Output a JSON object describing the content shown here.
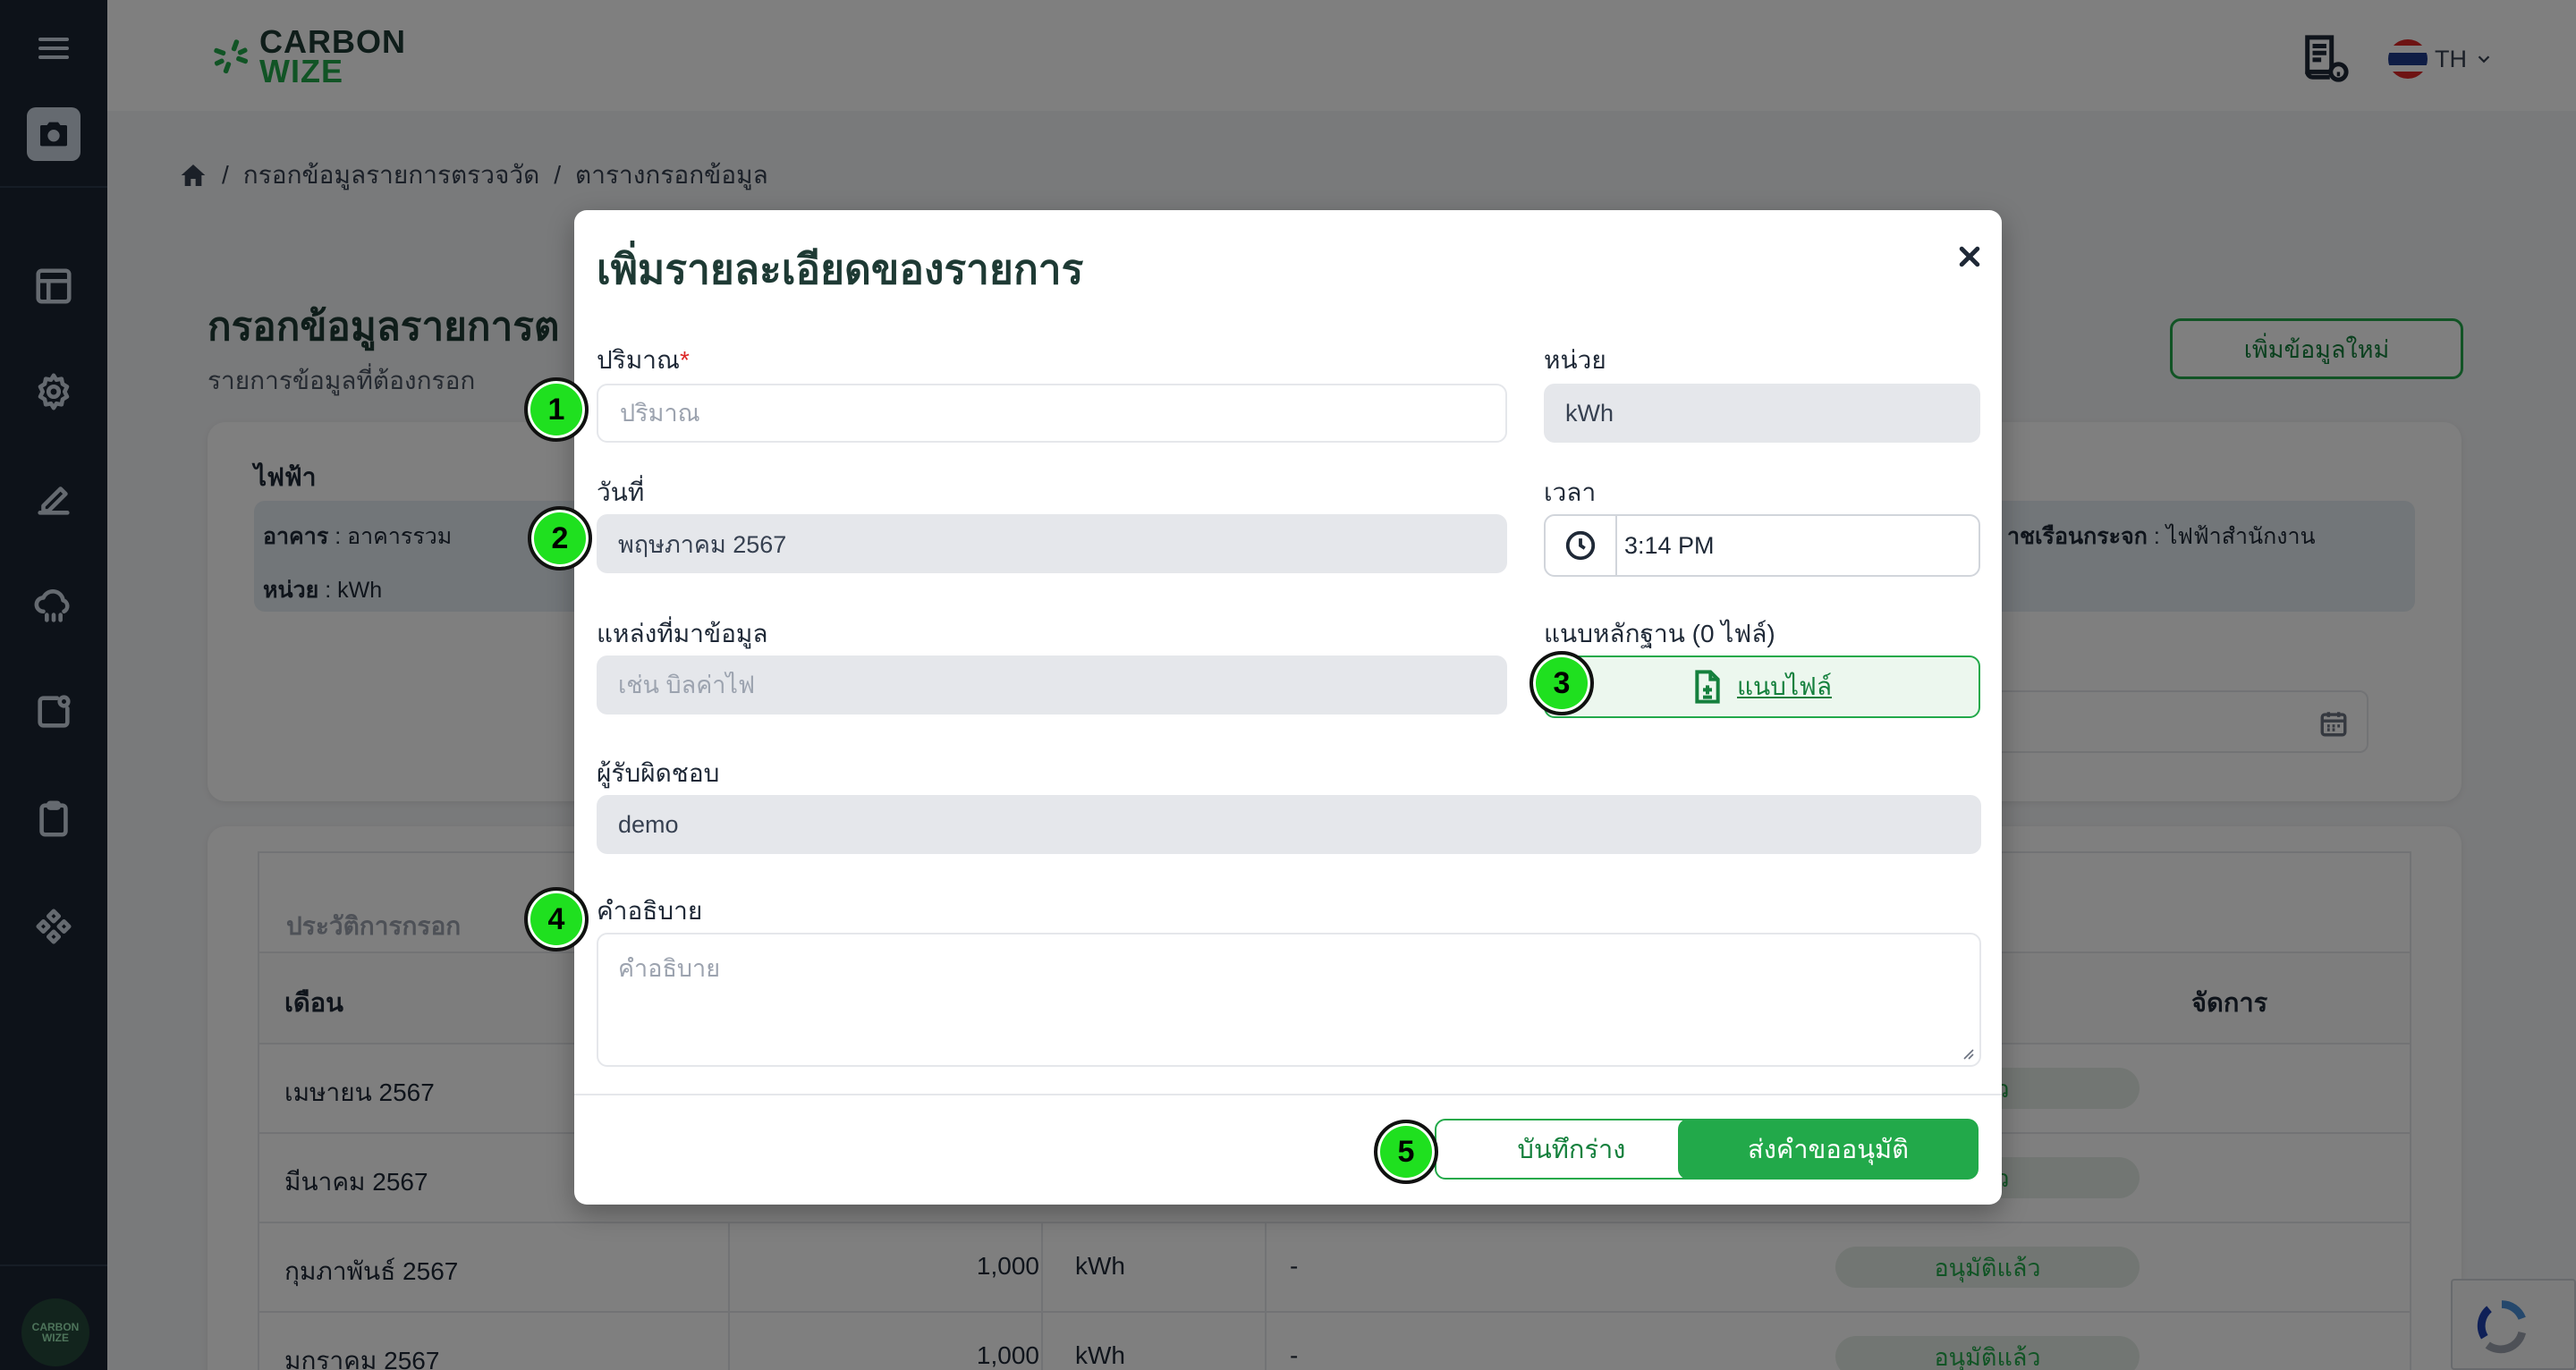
{
  "header": {
    "logo_line1": "CARBON",
    "logo_line2": "WIZE",
    "lang": "TH"
  },
  "sidebar": {
    "logo_line1": "CARBON",
    "logo_line2": "WIZE"
  },
  "breadcrumb": {
    "sep": "/",
    "item1": "กรอกข้อมูลรายการตรวจวัด",
    "item2": "ตารางกรอกข้อมูล"
  },
  "page": {
    "title": "กรอกข้อมูลรายการต",
    "subtitle": "รายการข้อมูลที่ต้องกรอก",
    "add_new": "เพิ่มข้อมูลใหม่"
  },
  "info": {
    "heading": "ไฟฟ้า",
    "building_label": "อาคาร",
    "building_value": " : อาคารรวม",
    "unit_label": "หน่วย",
    "unit_value": " : kWh",
    "right_label": "าชเรือนกระจก",
    "right_value": " : ไฟฟ้าสำนักงาน"
  },
  "history": {
    "title": "ประวัติการกรอก",
    "col_month": "เดือน",
    "col_manage": "จัดการ",
    "rows": [
      {
        "month": "เมษายน 2567",
        "amount": "",
        "unit": "",
        "note": "",
        "status": "แล้ว"
      },
      {
        "month": "มีนาคม 2567",
        "amount": "",
        "unit": "",
        "note": "",
        "status": "แล้ว"
      },
      {
        "month": "กุมภาพันธ์ 2567",
        "amount": "1,000",
        "unit": "kWh",
        "note": "-",
        "status": "อนุมัติแล้ว"
      },
      {
        "month": "มกราคม 2567",
        "amount": "1,000",
        "unit": "kWh",
        "note": "-",
        "status": "อนุมัติแล้ว"
      }
    ]
  },
  "modal": {
    "title": "เพิ่มรายละเอียดของรายการ",
    "quantity_label": "ปริมาณ",
    "required_mark": "*",
    "quantity_placeholder": "ปริมาณ",
    "unit_label": "หน่วย",
    "unit_value": "kWh",
    "date_label": "วันที่",
    "date_value": "พฤษภาคม 2567",
    "time_label": "เวลา",
    "time_value": "3:14 PM",
    "source_label": "แหล่งที่มาข้อมูล",
    "source_placeholder": "เช่น บิลค่าไฟ",
    "evidence_label": "แนบหลักฐาน (0 ไฟล์)",
    "attach_button": "แนบไฟล์",
    "responsible_label": "ผู้รับผิดชอบ",
    "responsible_value": "demo",
    "description_label": "คำอธิบาย",
    "description_placeholder": "คำอธิบาย",
    "draft_button": "บันทึกร่าง",
    "submit_button": "ส่งคำขออนุมัติ"
  },
  "markers": [
    "1",
    "2",
    "3",
    "4",
    "5"
  ],
  "colors": {
    "brand_green": "#22a94a",
    "sidebar_bg": "#1a2433",
    "title_green": "#1e3a34",
    "marker_green": "#1fe01f"
  },
  "icons": [
    "menu-icon",
    "camera-icon",
    "layout-icon",
    "gear-icon",
    "edit-icon",
    "cloud-rain-icon",
    "notification-square-icon",
    "clipboard-icon",
    "diamond-grid-icon",
    "document-info-icon",
    "thai-flag-icon",
    "chevron-down-icon",
    "home-icon",
    "calendar-icon",
    "close-icon",
    "clock-icon",
    "file-plus-icon"
  ]
}
